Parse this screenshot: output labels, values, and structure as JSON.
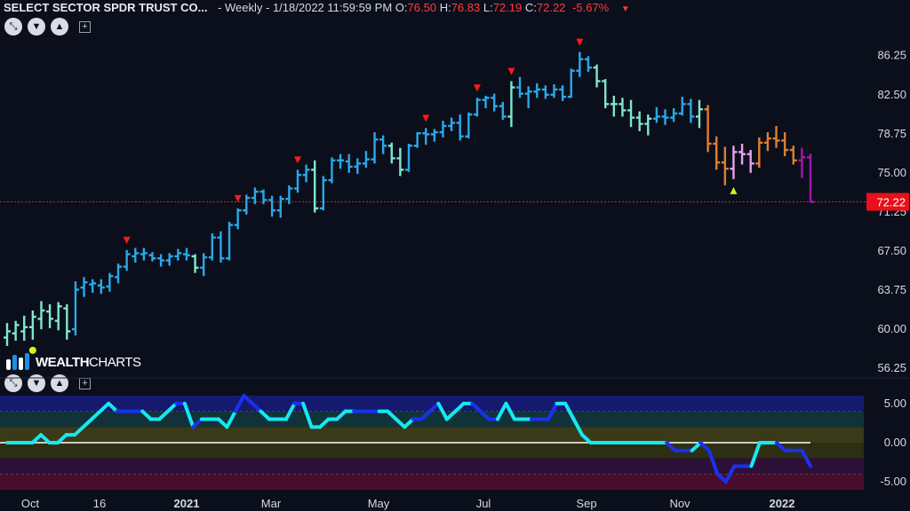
{
  "header": {
    "symbol": "SELECT SECTOR SPDR TRUST CO...",
    "meta": "- Weekly - 1/18/2022 11:59:59 PM",
    "o_label": "O:",
    "o_value": "76.50",
    "h_label": "H:",
    "h_value": "76.83",
    "l_label": "L:",
    "l_value": "72.19",
    "c_label": "C:",
    "c_value": "72.22",
    "change": "-5.67%",
    "down_marker": "▼"
  },
  "controls": {
    "collapse": "⤡",
    "down": "▼",
    "up": "▲",
    "add": "+"
  },
  "logo": {
    "bold": "WEALTH",
    "light": "CHARTS"
  },
  "colors": {
    "background": "#0b0f1c",
    "strong_up": "#2aa8e8",
    "weak_up": "#7fe6d0",
    "weak_down": "#e8a2e8",
    "down_orange": "#e07f2e",
    "strong_down": "#a018a8",
    "signal_red": "#ff1a1a",
    "signal_yellow": "#d8f21a",
    "oscillator_cyan": "#16e8f2",
    "oscillator_blue": "#1a30f0",
    "price_line": "#ff2020"
  },
  "chart_data": [
    {
      "type": "ohlc",
      "title": "SELECT SECTOR SPDR TRUST CO...",
      "interval": "Weekly",
      "price_axis_ticks": [
        "86.25",
        "82.50",
        "78.75",
        "75.00",
        "71.25",
        "67.50",
        "63.75",
        "60.00",
        "56.25"
      ],
      "ylim": [
        55.5,
        87.5
      ],
      "x_tick_labels": [
        "Oct",
        "16",
        "2021",
        "Mar",
        "May",
        "Jul",
        "Sep",
        "Nov",
        "2022"
      ],
      "last_price": "72.22",
      "bars": [
        {
          "o": 59.2,
          "h": 60.6,
          "l": 58.4,
          "c": 59.8,
          "color": "weak_up"
        },
        {
          "o": 59.6,
          "h": 60.8,
          "l": 58.9,
          "c": 60.4,
          "color": "weak_up"
        },
        {
          "o": 59.8,
          "h": 61.3,
          "l": 58.9,
          "c": 60.2,
          "color": "weak_up"
        },
        {
          "o": 60.2,
          "h": 61.8,
          "l": 59.0,
          "c": 61.2,
          "color": "weak_up"
        },
        {
          "o": 61.0,
          "h": 62.7,
          "l": 60.0,
          "c": 61.8,
          "color": "weak_up"
        },
        {
          "o": 61.7,
          "h": 62.4,
          "l": 60.1,
          "c": 61.0,
          "color": "weak_up"
        },
        {
          "o": 60.8,
          "h": 62.6,
          "l": 59.9,
          "c": 62.2,
          "color": "weak_up"
        },
        {
          "o": 62.0,
          "h": 62.4,
          "l": 59.0,
          "c": 59.8,
          "color": "weak_up"
        },
        {
          "o": 60.0,
          "h": 64.6,
          "l": 59.4,
          "c": 63.8,
          "color": "strong_up"
        },
        {
          "o": 64.0,
          "h": 65.0,
          "l": 63.1,
          "c": 64.5,
          "color": "strong_up"
        },
        {
          "o": 64.3,
          "h": 64.8,
          "l": 63.5,
          "c": 64.4,
          "color": "strong_up"
        },
        {
          "o": 64.2,
          "h": 64.8,
          "l": 63.4,
          "c": 64.0,
          "color": "strong_up"
        },
        {
          "o": 64.1,
          "h": 65.4,
          "l": 63.6,
          "c": 65.1,
          "color": "strong_up"
        },
        {
          "o": 65.0,
          "h": 66.3,
          "l": 64.4,
          "c": 66.0,
          "color": "strong_up"
        },
        {
          "o": 66.0,
          "h": 67.6,
          "l": 65.6,
          "c": 67.2,
          "color": "strong_up"
        },
        {
          "o": 67.0,
          "h": 67.8,
          "l": 66.4,
          "c": 67.3,
          "color": "strong_up"
        },
        {
          "o": 67.2,
          "h": 67.8,
          "l": 66.6,
          "c": 67.3,
          "color": "strong_up"
        },
        {
          "o": 67.1,
          "h": 67.4,
          "l": 66.5,
          "c": 66.8,
          "color": "strong_up"
        },
        {
          "o": 66.8,
          "h": 67.2,
          "l": 66.0,
          "c": 66.6,
          "color": "strong_up"
        },
        {
          "o": 66.6,
          "h": 67.3,
          "l": 66.1,
          "c": 67.0,
          "color": "strong_up"
        },
        {
          "o": 67.0,
          "h": 67.7,
          "l": 66.6,
          "c": 67.3,
          "color": "strong_up"
        },
        {
          "o": 67.2,
          "h": 67.8,
          "l": 66.6,
          "c": 67.1,
          "color": "strong_up"
        },
        {
          "o": 67.0,
          "h": 67.2,
          "l": 65.4,
          "c": 65.9,
          "color": "weak_up"
        },
        {
          "o": 65.9,
          "h": 67.3,
          "l": 65.1,
          "c": 66.9,
          "color": "strong_up"
        },
        {
          "o": 66.9,
          "h": 69.2,
          "l": 66.6,
          "c": 68.8,
          "color": "strong_up"
        },
        {
          "o": 68.8,
          "h": 69.4,
          "l": 66.4,
          "c": 66.8,
          "color": "strong_up"
        },
        {
          "o": 66.8,
          "h": 70.3,
          "l": 66.6,
          "c": 70.0,
          "color": "strong_up"
        },
        {
          "o": 70.0,
          "h": 71.6,
          "l": 69.6,
          "c": 71.4,
          "color": "strong_up"
        },
        {
          "o": 71.4,
          "h": 72.9,
          "l": 71.0,
          "c": 72.6,
          "color": "strong_up"
        },
        {
          "o": 72.6,
          "h": 73.6,
          "l": 72.0,
          "c": 73.2,
          "color": "strong_up"
        },
        {
          "o": 73.2,
          "h": 73.4,
          "l": 72.0,
          "c": 72.4,
          "color": "strong_up"
        },
        {
          "o": 72.4,
          "h": 72.8,
          "l": 70.8,
          "c": 71.4,
          "color": "strong_up"
        },
        {
          "o": 71.4,
          "h": 72.8,
          "l": 70.7,
          "c": 72.5,
          "color": "strong_up"
        },
        {
          "o": 72.5,
          "h": 73.8,
          "l": 72.0,
          "c": 73.5,
          "color": "strong_up"
        },
        {
          "o": 73.5,
          "h": 75.3,
          "l": 73.1,
          "c": 74.8,
          "color": "strong_up"
        },
        {
          "o": 74.8,
          "h": 75.8,
          "l": 74.1,
          "c": 75.3,
          "color": "strong_up"
        },
        {
          "o": 75.3,
          "h": 76.2,
          "l": 71.2,
          "c": 71.6,
          "color": "weak_up"
        },
        {
          "o": 71.6,
          "h": 74.7,
          "l": 71.4,
          "c": 74.3,
          "color": "strong_up"
        },
        {
          "o": 74.3,
          "h": 76.5,
          "l": 74.0,
          "c": 76.2,
          "color": "strong_up"
        },
        {
          "o": 76.2,
          "h": 76.8,
          "l": 75.4,
          "c": 76.2,
          "color": "strong_up"
        },
        {
          "o": 76.1,
          "h": 76.8,
          "l": 75.0,
          "c": 75.6,
          "color": "strong_up"
        },
        {
          "o": 75.6,
          "h": 76.4,
          "l": 74.9,
          "c": 75.9,
          "color": "strong_up"
        },
        {
          "o": 75.9,
          "h": 77.1,
          "l": 75.5,
          "c": 76.3,
          "color": "strong_up"
        },
        {
          "o": 76.3,
          "h": 78.9,
          "l": 75.9,
          "c": 78.2,
          "color": "strong_up"
        },
        {
          "o": 78.2,
          "h": 78.6,
          "l": 76.8,
          "c": 77.6,
          "color": "strong_up"
        },
        {
          "o": 77.6,
          "h": 77.9,
          "l": 75.9,
          "c": 76.4,
          "color": "weak_up"
        },
        {
          "o": 76.4,
          "h": 77.4,
          "l": 74.7,
          "c": 75.3,
          "color": "weak_up"
        },
        {
          "o": 75.3,
          "h": 77.8,
          "l": 75.1,
          "c": 77.6,
          "color": "strong_up"
        },
        {
          "o": 77.6,
          "h": 78.9,
          "l": 77.4,
          "c": 78.8,
          "color": "strong_up"
        },
        {
          "o": 78.8,
          "h": 79.3,
          "l": 77.7,
          "c": 78.7,
          "color": "strong_up"
        },
        {
          "o": 78.7,
          "h": 79.2,
          "l": 78.0,
          "c": 78.9,
          "color": "strong_up"
        },
        {
          "o": 78.9,
          "h": 80.0,
          "l": 78.4,
          "c": 79.5,
          "color": "strong_up"
        },
        {
          "o": 79.5,
          "h": 80.3,
          "l": 79.0,
          "c": 79.8,
          "color": "strong_up"
        },
        {
          "o": 79.8,
          "h": 80.6,
          "l": 78.1,
          "c": 78.5,
          "color": "strong_up"
        },
        {
          "o": 78.5,
          "h": 80.8,
          "l": 78.3,
          "c": 80.6,
          "color": "strong_up"
        },
        {
          "o": 80.6,
          "h": 82.2,
          "l": 80.4,
          "c": 82.0,
          "color": "strong_up"
        },
        {
          "o": 82.0,
          "h": 82.4,
          "l": 81.2,
          "c": 82.2,
          "color": "strong_up"
        },
        {
          "o": 82.2,
          "h": 82.6,
          "l": 80.9,
          "c": 81.4,
          "color": "strong_up"
        },
        {
          "o": 81.4,
          "h": 81.8,
          "l": 80.1,
          "c": 80.4,
          "color": "strong_up"
        },
        {
          "o": 80.4,
          "h": 83.8,
          "l": 79.4,
          "c": 83.2,
          "color": "weak_up"
        },
        {
          "o": 83.2,
          "h": 84.2,
          "l": 82.2,
          "c": 82.6,
          "color": "strong_up"
        },
        {
          "o": 82.6,
          "h": 83.3,
          "l": 81.2,
          "c": 82.8,
          "color": "strong_up"
        },
        {
          "o": 82.8,
          "h": 83.6,
          "l": 82.2,
          "c": 83.0,
          "color": "strong_up"
        },
        {
          "o": 83.0,
          "h": 83.4,
          "l": 82.1,
          "c": 82.5,
          "color": "strong_up"
        },
        {
          "o": 82.5,
          "h": 83.5,
          "l": 82.2,
          "c": 83.0,
          "color": "strong_up"
        },
        {
          "o": 83.0,
          "h": 83.4,
          "l": 81.9,
          "c": 82.3,
          "color": "strong_up"
        },
        {
          "o": 82.3,
          "h": 85.0,
          "l": 82.2,
          "c": 84.8,
          "color": "strong_up"
        },
        {
          "o": 84.8,
          "h": 86.6,
          "l": 84.2,
          "c": 85.9,
          "color": "strong_up"
        },
        {
          "o": 85.9,
          "h": 86.2,
          "l": 84.7,
          "c": 85.1,
          "color": "strong_up"
        },
        {
          "o": 85.1,
          "h": 85.4,
          "l": 83.2,
          "c": 83.8,
          "color": "weak_up"
        },
        {
          "o": 83.8,
          "h": 84.0,
          "l": 81.2,
          "c": 81.6,
          "color": "weak_up"
        },
        {
          "o": 81.6,
          "h": 82.4,
          "l": 80.4,
          "c": 81.6,
          "color": "weak_up"
        },
        {
          "o": 81.6,
          "h": 82.2,
          "l": 80.4,
          "c": 81.0,
          "color": "weak_up"
        },
        {
          "o": 81.0,
          "h": 82.0,
          "l": 79.4,
          "c": 80.3,
          "color": "weak_up"
        },
        {
          "o": 80.3,
          "h": 80.9,
          "l": 79.0,
          "c": 79.7,
          "color": "weak_up"
        },
        {
          "o": 79.7,
          "h": 80.6,
          "l": 78.6,
          "c": 80.2,
          "color": "weak_up"
        },
        {
          "o": 80.2,
          "h": 81.3,
          "l": 79.8,
          "c": 80.4,
          "color": "strong_up"
        },
        {
          "o": 80.4,
          "h": 81.1,
          "l": 79.6,
          "c": 80.3,
          "color": "strong_up"
        },
        {
          "o": 80.3,
          "h": 81.2,
          "l": 79.9,
          "c": 80.7,
          "color": "strong_up"
        },
        {
          "o": 80.7,
          "h": 82.3,
          "l": 80.5,
          "c": 81.6,
          "color": "strong_up"
        },
        {
          "o": 81.6,
          "h": 82.1,
          "l": 79.8,
          "c": 80.4,
          "color": "strong_up"
        },
        {
          "o": 80.4,
          "h": 82.0,
          "l": 79.3,
          "c": 81.1,
          "color": "weak_up"
        },
        {
          "o": 81.1,
          "h": 81.5,
          "l": 77.0,
          "c": 77.8,
          "color": "down_orange"
        },
        {
          "o": 77.8,
          "h": 78.5,
          "l": 75.3,
          "c": 76.0,
          "color": "down_orange"
        },
        {
          "o": 76.0,
          "h": 77.5,
          "l": 73.8,
          "c": 75.4,
          "color": "down_orange"
        },
        {
          "o": 75.4,
          "h": 77.6,
          "l": 74.4,
          "c": 77.0,
          "color": "weak_down"
        },
        {
          "o": 77.0,
          "h": 77.8,
          "l": 75.8,
          "c": 76.8,
          "color": "weak_down"
        },
        {
          "o": 76.8,
          "h": 77.2,
          "l": 75.0,
          "c": 75.9,
          "color": "weak_down"
        },
        {
          "o": 75.9,
          "h": 78.4,
          "l": 75.5,
          "c": 77.9,
          "color": "down_orange"
        },
        {
          "o": 77.9,
          "h": 78.9,
          "l": 77.1,
          "c": 78.3,
          "color": "down_orange"
        },
        {
          "o": 78.3,
          "h": 79.5,
          "l": 77.4,
          "c": 78.1,
          "color": "down_orange"
        },
        {
          "o": 78.1,
          "h": 78.9,
          "l": 76.6,
          "c": 77.2,
          "color": "down_orange"
        },
        {
          "o": 77.2,
          "h": 77.6,
          "l": 75.8,
          "c": 76.2,
          "color": "down_orange"
        },
        {
          "o": 76.2,
          "h": 77.4,
          "l": 74.5,
          "c": 76.5,
          "color": "strong_down"
        },
        {
          "o": 76.5,
          "h": 76.83,
          "l": 72.19,
          "c": 72.22,
          "color": "strong_down"
        }
      ],
      "high_signals_bar_index": [
        14,
        27,
        34,
        49,
        55,
        59,
        67
      ],
      "low_signals_bar_index": [
        3,
        85
      ]
    },
    {
      "type": "line",
      "oscillator_axis_ticks": [
        "5.00",
        "0.00",
        "-5.00"
      ],
      "ylim": [
        -6.0,
        6.0
      ],
      "values": [
        0,
        0,
        0,
        0,
        1,
        0,
        0,
        1,
        1,
        2,
        3,
        4,
        5,
        4,
        4,
        4,
        4,
        3,
        3,
        4,
        5,
        5,
        2,
        3,
        3,
        3,
        2,
        4,
        6,
        5,
        4,
        3,
        3,
        3,
        5,
        5,
        2,
        2,
        3,
        3,
        4,
        4,
        4,
        4,
        4,
        4,
        3,
        2,
        3,
        3,
        4,
        5,
        3,
        4,
        5,
        5,
        4,
        3,
        3,
        5,
        3,
        3,
        3,
        3,
        3,
        5,
        5,
        3,
        1,
        0,
        0,
        0,
        0,
        0,
        0,
        0,
        0,
        0,
        0,
        -1,
        -1,
        -1,
        0,
        -1,
        -4,
        -5,
        -3,
        -3,
        -3,
        0,
        0,
        0,
        -1,
        -1,
        -1,
        -3
      ],
      "zero_line_value": 0
    }
  ]
}
